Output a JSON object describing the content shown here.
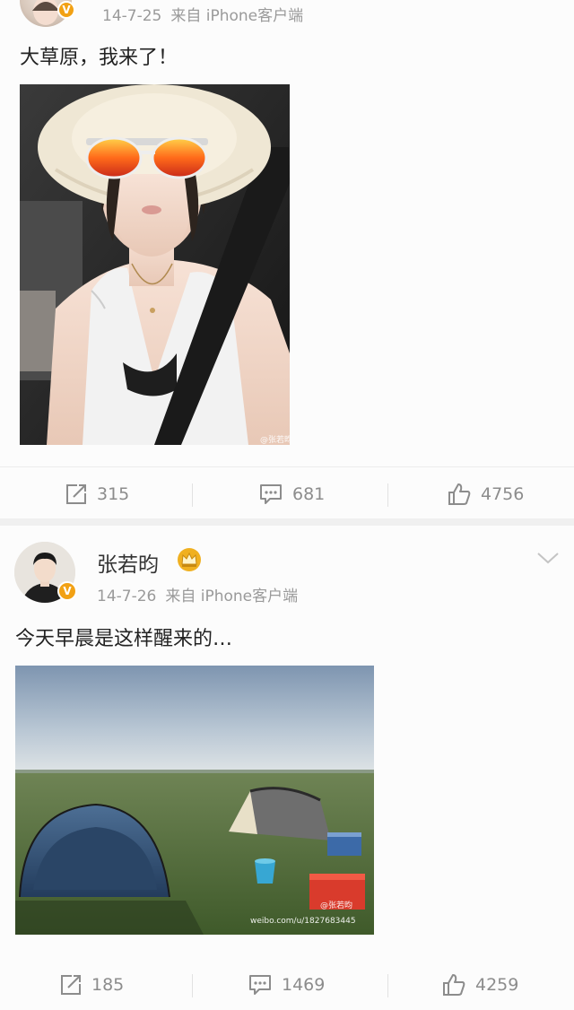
{
  "post1": {
    "timestamp": "14-7-25",
    "source": "来自 iPhone客户端",
    "text": "大草原，我来了！",
    "image_watermark": "@张若昀",
    "actions": {
      "repost": "315",
      "comment": "681",
      "like": "4756"
    }
  },
  "post2": {
    "username": "张若昀",
    "timestamp": "14-7-26",
    "source": "来自 iPhone客户端",
    "text": "今天早晨是这样醒来的…",
    "image_watermark": "@张若昀",
    "image_url_watermark": "weibo.com/u/1827683445",
    "actions": {
      "repost": "185",
      "comment": "1469",
      "like": "4259"
    }
  },
  "colors": {
    "verified_badge": "#f2a114",
    "crown": "#f0b020",
    "meta_text": "#9a9a9a",
    "action_text": "#8c8c8c"
  }
}
